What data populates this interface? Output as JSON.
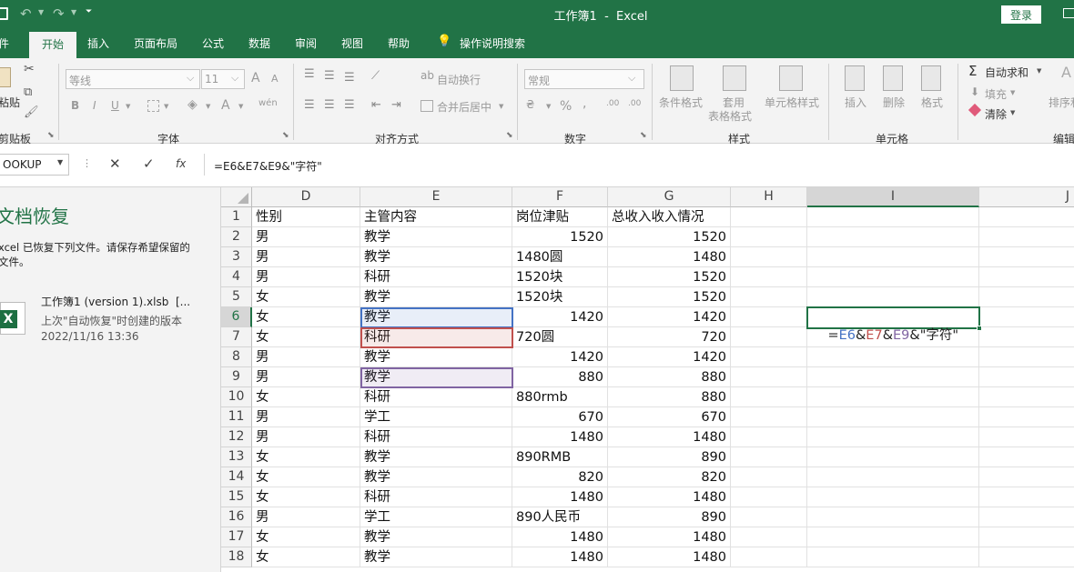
{
  "titlebar": {
    "title": "工作簿1  -  Excel",
    "login": "登录"
  },
  "tabs": [
    "件",
    "开始",
    "插入",
    "页面布局",
    "公式",
    "数据",
    "审阅",
    "视图",
    "帮助"
  ],
  "tell_me": "操作说明搜索",
  "ribbon": {
    "clipboard": {
      "paste": "粘贴",
      "group": "剪贴板"
    },
    "font": {
      "name": "等线",
      "size": "11",
      "bold": "B",
      "italic": "I",
      "underline": "U",
      "grow": "A",
      "shrink": "A",
      "color_a": "A",
      "phonetic": "wén",
      "group": "字体"
    },
    "alignment": {
      "wrap": "自动换行",
      "merge": "合并后居中",
      "group": "对齐方式"
    },
    "number": {
      "format": "常规",
      "percent": "%",
      "comma": ",",
      "group": "数字"
    },
    "styles": {
      "cond": "条件格式",
      "table_1": "套用",
      "table_2": "表格格式",
      "cell": "单元格样式",
      "group": "样式"
    },
    "cells": {
      "insert": "插入",
      "delete": "删除",
      "format": "格式",
      "group": "单元格"
    },
    "editing": {
      "autosum": "自动求和",
      "fill": "填充",
      "clear": "清除",
      "sort": "排序和",
      "group": "编辑"
    }
  },
  "formula_bar": {
    "name_box": "OOKUP",
    "fx": "fx",
    "formula": "=E6&E7&E9&\"字符\""
  },
  "recovery": {
    "title": "文档恢复",
    "desc_1": "xcel 已恢复下列文件。请保存希望保留的",
    "desc_2": "文件。",
    "file_name": "工作簿1 (version 1).xlsb  [...",
    "file_desc": "上次\"自动恢复\"时创建的版本",
    "file_time": "2022/11/16 13:36"
  },
  "columns": [
    "D",
    "E",
    "F",
    "G",
    "H",
    "I",
    "J"
  ],
  "rows": [
    [
      "1",
      "性别",
      "主管内容",
      "岗位津贴",
      "总收入收入情况"
    ],
    [
      "2",
      "男",
      "教学",
      "1520",
      "1520"
    ],
    [
      "3",
      "男",
      "教学",
      "1480圆",
      "1480"
    ],
    [
      "4",
      "男",
      "科研",
      "1520块",
      "1520"
    ],
    [
      "5",
      "女",
      "教学",
      "1520块",
      "1520"
    ],
    [
      "6",
      "女",
      "教学",
      "1420",
      "1420"
    ],
    [
      "7",
      "女",
      "科研",
      "720圆",
      "720"
    ],
    [
      "8",
      "男",
      "教学",
      "1420",
      "1420"
    ],
    [
      "9",
      "男",
      "教学",
      "880",
      "880"
    ],
    [
      "10",
      "女",
      "科研",
      "880rmb",
      "880"
    ],
    [
      "11",
      "男",
      "学工",
      "670",
      "670"
    ],
    [
      "12",
      "男",
      "科研",
      "1480",
      "1480"
    ],
    [
      "13",
      "女",
      "教学",
      "890RMB",
      "890"
    ],
    [
      "14",
      "女",
      "教学",
      "820",
      "820"
    ],
    [
      "15",
      "女",
      "科研",
      "1480",
      "1480"
    ],
    [
      "16",
      "男",
      "学工",
      "890人民币",
      "890"
    ],
    [
      "17",
      "女",
      "教学",
      "1480",
      "1480"
    ],
    [
      "18",
      "女",
      "教学",
      "1480",
      "1480"
    ]
  ],
  "edit_cell": {
    "p1": "=",
    "p2": "E6",
    "p3": "&",
    "p4": "E7",
    "p5": "&",
    "p6": "E9",
    "p7": "&\"字符\""
  },
  "colors": {
    "accent": "#217346",
    "ref1": "#4472c4",
    "ref2": "#c0504d",
    "ref3": "#8064a2"
  }
}
